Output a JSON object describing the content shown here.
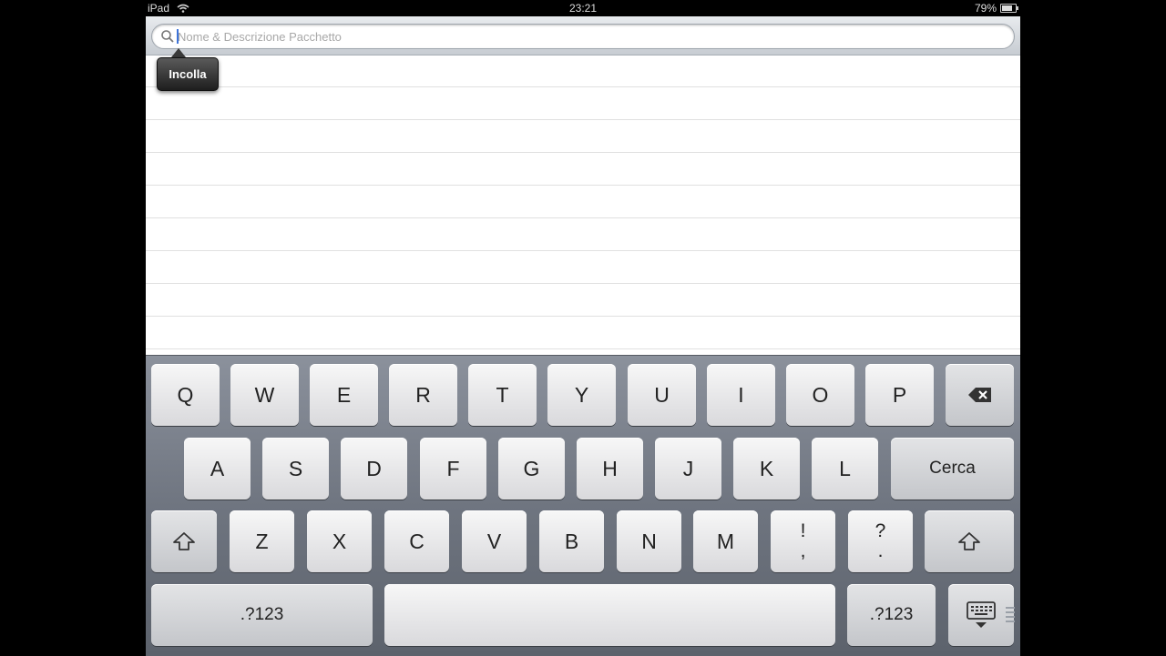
{
  "status_bar": {
    "device": "iPad",
    "time": "23:21",
    "battery_percent": "79%",
    "battery_level": 0.79
  },
  "search": {
    "placeholder": "Nome & Descrizione Pacchetto",
    "value": ""
  },
  "popup": {
    "paste_label": "Incolla"
  },
  "list": {
    "row_count": 9
  },
  "keyboard": {
    "row1": [
      "Q",
      "W",
      "E",
      "R",
      "T",
      "Y",
      "U",
      "I",
      "O",
      "P"
    ],
    "row2": [
      "A",
      "S",
      "D",
      "F",
      "G",
      "H",
      "J",
      "K",
      "L"
    ],
    "row3": [
      "Z",
      "X",
      "C",
      "V",
      "B",
      "N",
      "M"
    ],
    "search_key": "Cerca",
    "punct1_top": "!",
    "punct1_bottom": ",",
    "punct2_top": "?",
    "punct2_bottom": ".",
    "numbers_left": ".?123",
    "numbers_right": ".?123"
  }
}
